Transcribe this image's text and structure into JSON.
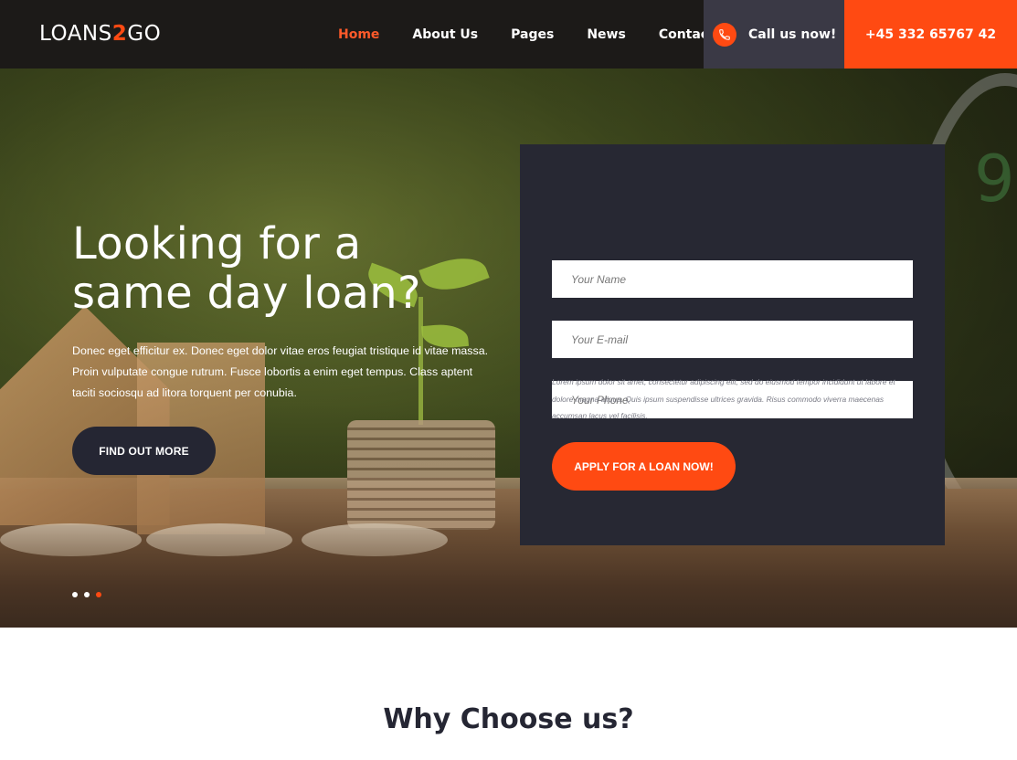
{
  "header": {
    "logo_part1": "LOANS",
    "logo_accent": "2",
    "logo_part2": "GO",
    "nav": [
      {
        "label": "Home",
        "active": true
      },
      {
        "label": "About Us",
        "active": false
      },
      {
        "label": "Pages",
        "active": false
      },
      {
        "label": "News",
        "active": false
      },
      {
        "label": "Contact",
        "active": false
      }
    ],
    "call_label": "Call us now!",
    "phone": "+45 332 65767 42",
    "phone_icon": "phone-icon"
  },
  "hero": {
    "title": "Looking for a same day loan?",
    "description": "Donec eget efficitur ex. Donec eget dolor vitae eros feugiat tristique id vitae massa. Proin vulputate congue rutrum. Fusce lobortis a enim eget tempus. Class aptent taciti sociosqu ad litora torquent per conubia.",
    "cta_label": "FIND OUT MORE",
    "slider_dots": 3,
    "active_dot": 3
  },
  "form": {
    "name_placeholder": "Your Name",
    "email_placeholder": "Your E-mail",
    "phone_placeholder": "Your Phone",
    "note": "Lorem ipsum dolor sit amet, consectetur adipiscing elit, sed do eiusmod tempor incididunt ut labore et dolore magna aliqua. Quis ipsum suspendisse ultrices gravida. Risus commodo viverra maecenas accumsan lacus vel facilisis.",
    "submit_label": "APPLY FOR A LOAN NOW!"
  },
  "section": {
    "title": "Why Choose us?"
  },
  "colors": {
    "accent": "#ff4a12",
    "dark": "#252633",
    "header_bg": "#1c1a18",
    "call_bg": "#3a3945"
  }
}
